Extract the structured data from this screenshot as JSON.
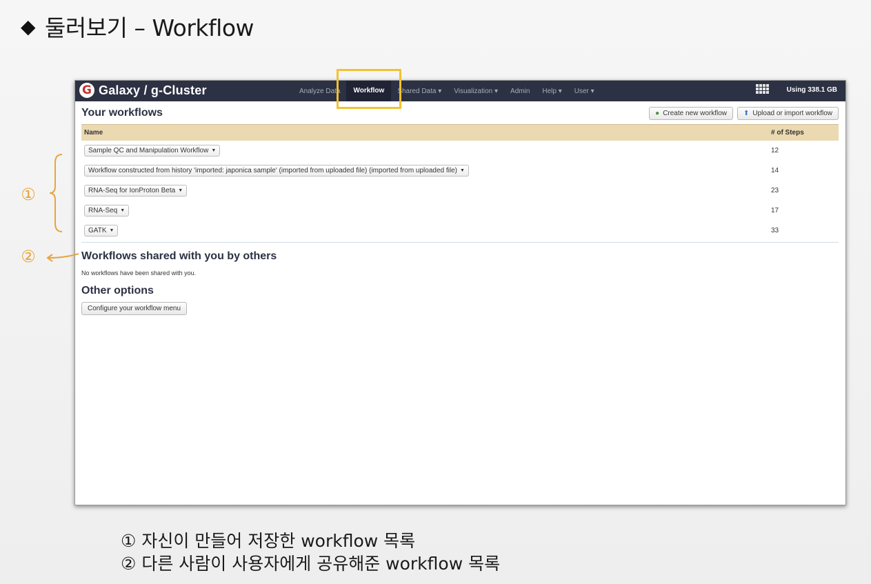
{
  "slide": {
    "title_bullet": "◆",
    "title": "둘러보기 – Workflow",
    "captions": [
      "① 자신이 만들어 저장한 workflow 목록",
      "② 다른 사람이 사용자에게 공유해준 workflow 목록"
    ],
    "annotations": [
      "①",
      "②"
    ],
    "accent_color": "#f2c230"
  },
  "masthead": {
    "logo": "G",
    "brand": "Galaxy / g-Cluster",
    "nav": [
      "Analyze Data",
      "Workflow",
      "Shared Data ▾",
      "Visualization ▾",
      "Admin",
      "Help ▾",
      "User ▾"
    ],
    "active_nav": "Workflow",
    "quota": "Using 338.1 GB"
  },
  "your_workflows": {
    "heading": "Your workflows",
    "create_button": "Create new workflow",
    "upload_button": "Upload or import workflow",
    "columns": [
      "Name",
      "# of Steps"
    ],
    "rows": [
      {
        "name": "Sample QC and Manipulation Workflow",
        "steps": "12"
      },
      {
        "name": "Workflow constructed from history 'imported: japonica sample' (imported from uploaded file) (imported from uploaded file)",
        "steps": "14"
      },
      {
        "name": "RNA-Seq for IonProton Beta",
        "steps": "23"
      },
      {
        "name": "RNA-Seq",
        "steps": "17"
      },
      {
        "name": "GATK",
        "steps": "33"
      }
    ]
  },
  "shared": {
    "heading": "Workflows shared with you by others",
    "empty_note": "No workflows have been shared with you."
  },
  "options": {
    "heading": "Other options",
    "configure_button": "Configure your workflow menu"
  }
}
